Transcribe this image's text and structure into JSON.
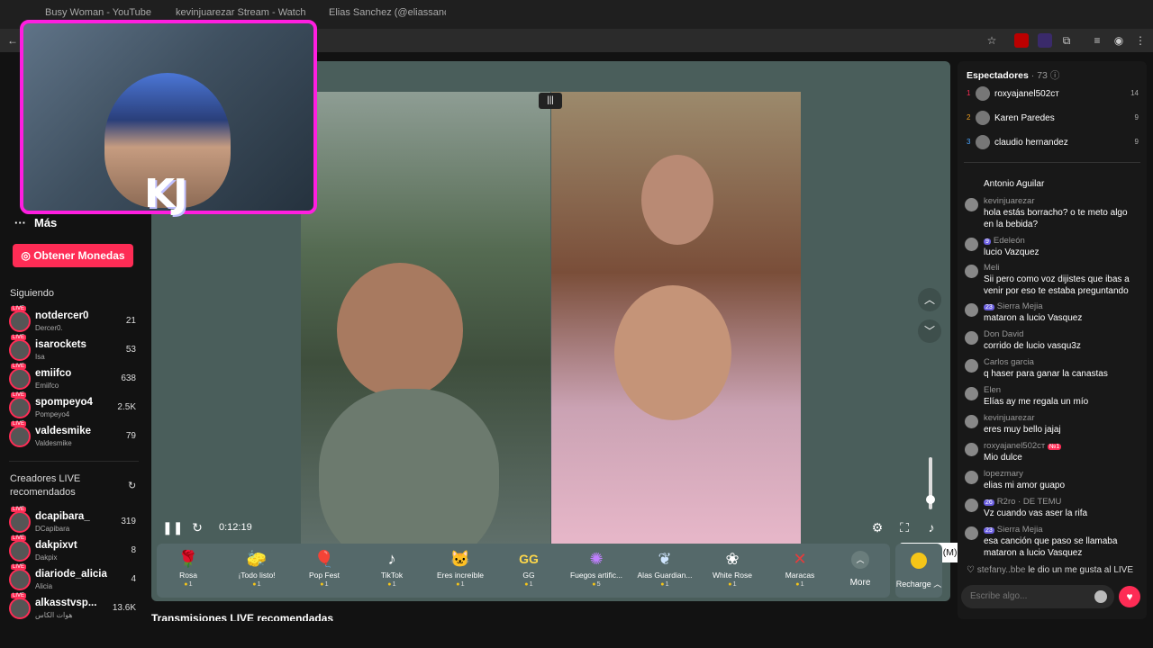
{
  "browser": {
    "tabs": [
      {
        "label": "Busy Woman - YouTube"
      },
      {
        "label": "kevinjuarezar Stream - Watch"
      },
      {
        "label": "Elias Sanchez (@eliassanc..."
      }
    ]
  },
  "sidebar": {
    "more_label": "Más",
    "coins_button": "Obtener Monedas",
    "following_title": "Siguiendo",
    "following": [
      {
        "name": "notdercer0",
        "sub": "Dercer0.",
        "count": "21"
      },
      {
        "name": "isarockets",
        "sub": "Isa",
        "count": "53"
      },
      {
        "name": "emiifco",
        "sub": "Emiifco",
        "count": "638"
      },
      {
        "name": "spompeyo4",
        "sub": "Pompeyo4",
        "count": "2.5K"
      },
      {
        "name": "valdesmike",
        "sub": "Valdesmike",
        "count": "79"
      }
    ],
    "recommended_title_1": "Creadores LIVE",
    "recommended_title_2": "recomendados",
    "recommended": [
      {
        "name": "dcapibara_",
        "sub": "DCapibara",
        "count": "319"
      },
      {
        "name": "dakpixvt",
        "sub": "Dakpix",
        "count": "8"
      },
      {
        "name": "diariode_alicia",
        "sub": "Alicia",
        "count": "4"
      },
      {
        "name": "alkasstvsp...",
        "sub": "هوات الكاس",
        "count": "13.6K"
      }
    ]
  },
  "player": {
    "time": "0:12:19",
    "mute_tooltip": "Silenciar (M)"
  },
  "gifts": [
    {
      "name": "Rosa",
      "price": "1",
      "icon": "🌹"
    },
    {
      "name": "¡Todo listo!",
      "price": "1",
      "icon": "🧽"
    },
    {
      "name": "Pop Fest",
      "price": "1",
      "icon": "🎈"
    },
    {
      "name": "TikTok",
      "price": "1",
      "icon": "♪"
    },
    {
      "name": "Eres increíble",
      "price": "1",
      "icon": "🐱"
    },
    {
      "name": "GG",
      "price": "1",
      "icon": "GG"
    },
    {
      "name": "Fuegos artific...",
      "price": "5",
      "icon": "✺"
    },
    {
      "name": "Alas Guardian...",
      "price": "1",
      "icon": "❦"
    },
    {
      "name": "White Rose",
      "price": "1",
      "icon": "❀"
    },
    {
      "name": "Maracas",
      "price": "1",
      "icon": "✕"
    }
  ],
  "gift_more": "More",
  "recharge": "Recharge",
  "recommended_streams": "Transmisiones LIVE recomendadas",
  "overlay_label": "KJ",
  "viewers": {
    "title": "Espectadores",
    "count": "· 73",
    "top": [
      {
        "rank": "1",
        "name": "roxyajanel502ᴄᴛ",
        "score": "14"
      },
      {
        "rank": "2",
        "name": "Karen Paredes",
        "score": "9"
      },
      {
        "rank": "3",
        "name": "claudio hernandez",
        "score": "9"
      }
    ]
  },
  "chat": [
    {
      "user": "",
      "text": "Antonio Aguilar"
    },
    {
      "user": "kevinjuarezar",
      "text": "hola estás borracho? o te meto algo en la bebida?"
    },
    {
      "user": "Edeleón",
      "badge": "9",
      "text": "lucio Vazquez"
    },
    {
      "user": "Meli",
      "text": "Sii pero como voz dijistes que ibas a venir por eso te estaba preguntando"
    },
    {
      "user": "Sierra Mejia",
      "badge": "23",
      "text": "mataron a lucio Vasquez"
    },
    {
      "user": "Don David",
      "text": "corrido de lucio vasqu3z"
    },
    {
      "user": "Carlos garcia",
      "text": "q haser para ganar la canastas"
    },
    {
      "user": "Elen",
      "text": "Elías ay me regala un mío"
    },
    {
      "user": "kevinjuarezar",
      "text": "eres muy bello jajaj"
    },
    {
      "user": "roxyajanel502ᴄᴛ",
      "badge": "№1",
      "text": "Mio dulce"
    },
    {
      "user": "lopezmary",
      "text": "elias mi amor guapo"
    },
    {
      "user": "R2ro · DE TEMU",
      "badge": "26",
      "text": "Vz cuando vas aser la rifa"
    },
    {
      "user": "Sierra Mejia",
      "badge": "23",
      "text": "esa canción que paso se llamaba mataron a lucio Vasquez"
    }
  ],
  "join": {
    "user": "stefany..bbe",
    "text": "le dio un me gusta al LIVE"
  },
  "chat_input_placeholder": "Escribe algo...",
  "colors": {
    "accent": "#fe2c55",
    "stage": "#4a5e5b",
    "overlay_border": "#ff1ee0"
  }
}
